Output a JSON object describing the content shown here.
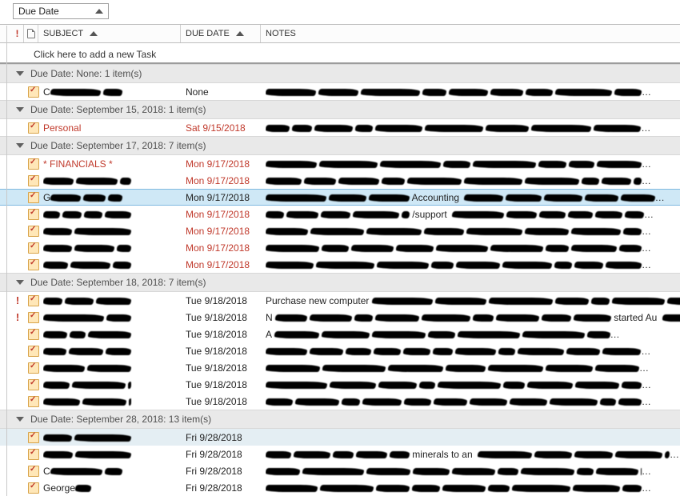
{
  "sort_field": "Due Date",
  "columns": {
    "subject": "Subject",
    "duedate": "Due Date",
    "notes": "Notes"
  },
  "add_prompt": "Click here to add a new Task",
  "groups": [
    {
      "title": "Due Date: None: 1 item(s)",
      "tasks": [
        {
          "subject_prefix": "C",
          "due": "None",
          "overdue": false
        }
      ]
    },
    {
      "title": "Due Date: September 15, 2018: 1 item(s)",
      "tasks": [
        {
          "subject": "Personal",
          "due": "Sat 9/15/2018",
          "overdue": true
        }
      ]
    },
    {
      "title": "Due Date: September 17, 2018: 7 item(s)",
      "tasks": [
        {
          "subject": "* FINANCIALS *",
          "due": "Mon 9/17/2018",
          "overdue": true
        },
        {
          "subject_redacted": true,
          "due": "Mon 9/17/2018",
          "overdue": true
        },
        {
          "subject_prefix": "G",
          "due": "Mon 9/17/2018",
          "overdue": false,
          "selected": true,
          "note_frag": "Accounting"
        },
        {
          "subject_redacted": true,
          "due": "Mon 9/17/2018",
          "overdue": true,
          "note_frag": "/support"
        },
        {
          "subject_redacted": true,
          "due": "Mon 9/17/2018",
          "overdue": true
        },
        {
          "subject_redacted": true,
          "due": "Mon 9/17/2018",
          "overdue": true
        },
        {
          "subject_redacted": true,
          "due": "Mon 9/17/2018",
          "overdue": true
        }
      ]
    },
    {
      "title": "Due Date: September 18, 2018: 7 item(s)",
      "tasks": [
        {
          "priority": true,
          "subject_redacted": true,
          "due": "Tue 9/18/2018",
          "note_clear": "Purchase new computer"
        },
        {
          "priority": true,
          "subject_redacted": true,
          "due": "Tue 9/18/2018",
          "note_clear": "N",
          "note_frag2": "started Au"
        },
        {
          "subject_redacted": true,
          "due": "Tue 9/18/2018",
          "note_clear": "A"
        },
        {
          "subject_redacted": true,
          "due": "Tue 9/18/2018"
        },
        {
          "subject_redacted": true,
          "due": "Tue 9/18/2018"
        },
        {
          "subject_redacted": true,
          "due": "Tue 9/18/2018"
        },
        {
          "subject_redacted": true,
          "due": "Tue 9/18/2018"
        }
      ]
    },
    {
      "title": "Due Date: September 28, 2018: 13 item(s)",
      "tasks": [
        {
          "subject_redacted": true,
          "due": "Fri 9/28/2018",
          "hover": true,
          "no_notes": true
        },
        {
          "subject_redacted": true,
          "due": "Fri 9/28/2018",
          "note_frag": "minerals to an"
        },
        {
          "subject_prefix": "C",
          "due": "Fri 9/28/2018"
        },
        {
          "subject": "George",
          "subject_redacted_suffix": true,
          "due": "Fri 9/28/2018"
        }
      ]
    }
  ]
}
